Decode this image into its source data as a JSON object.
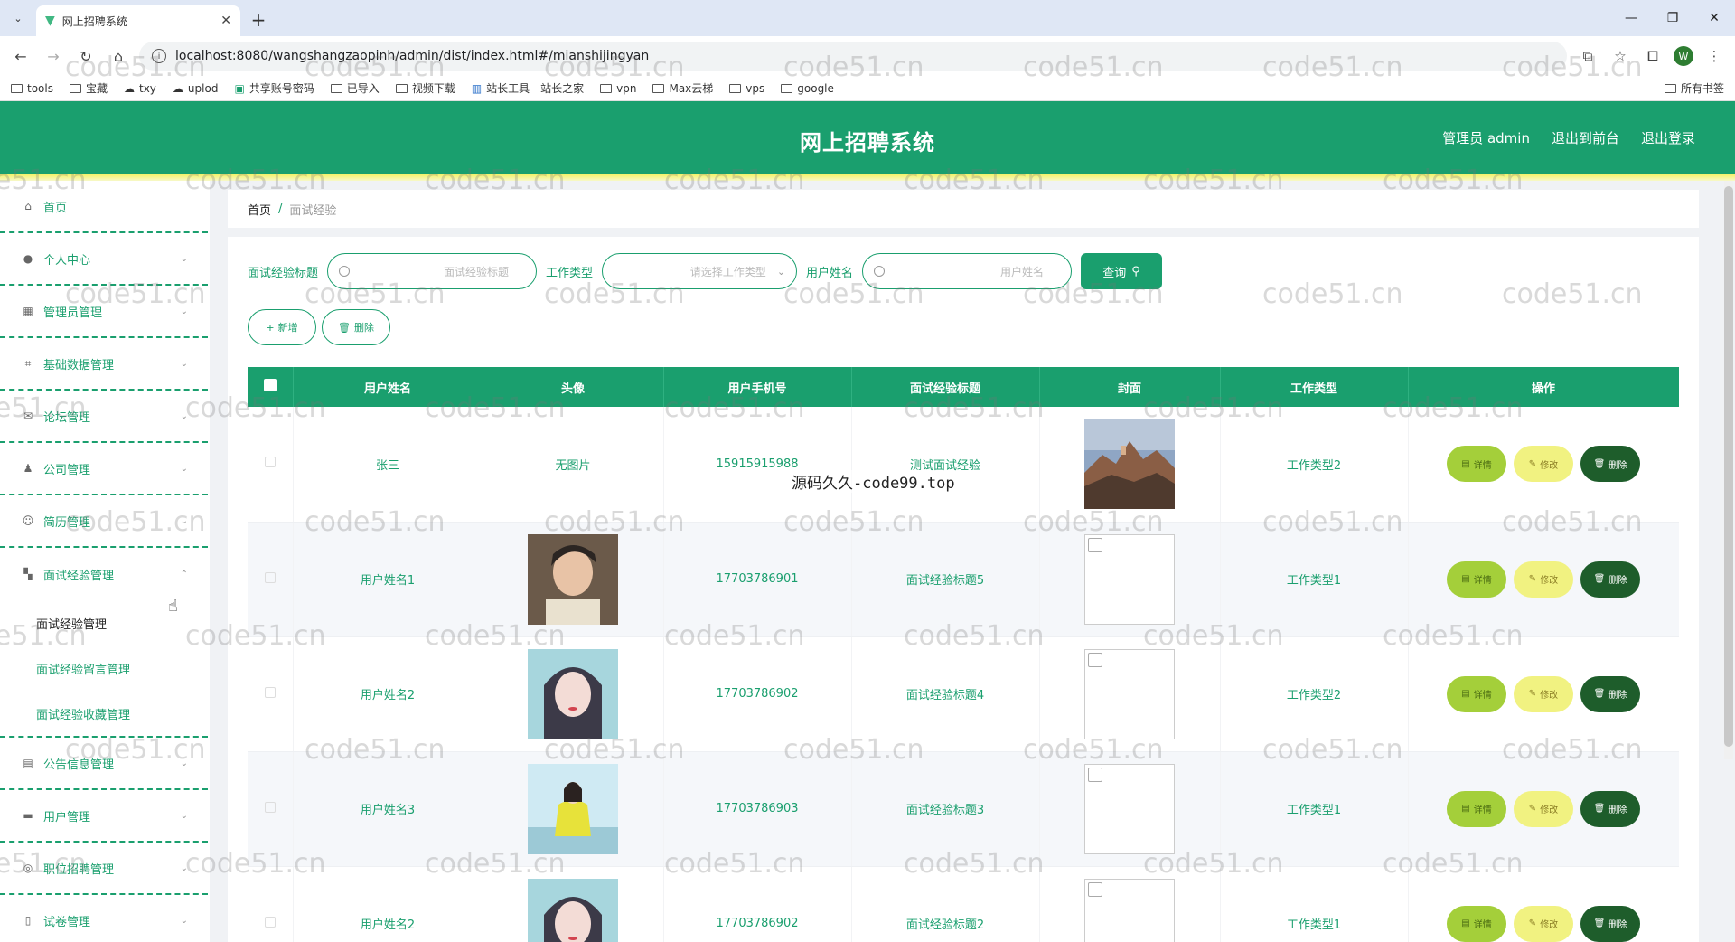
{
  "browser": {
    "tab_title": "网上招聘系统",
    "url": "localhost:8080/wangshangzaopinh/admin/dist/index.html#/mianshijingyan",
    "profile_initial": "W",
    "bookmarks": [
      "tools",
      "宝藏",
      "txy",
      "uplod",
      "共享账号密码",
      "已导入",
      "视频下载",
      "站长工具 - 站长之家",
      "vpn",
      "Max云梯",
      "vps",
      "google"
    ],
    "all_bookmarks": "所有书签"
  },
  "header": {
    "title": "网上招聘系统",
    "admin_label": "管理员 admin",
    "to_front": "退出到前台",
    "logout": "退出登录"
  },
  "sidebar": {
    "items": [
      {
        "label": "首页",
        "icon": "home-icon"
      },
      {
        "label": "个人中心",
        "icon": "user-icon"
      },
      {
        "label": "管理员管理",
        "icon": "admin-icon"
      },
      {
        "label": "基础数据管理",
        "icon": "crop-icon"
      },
      {
        "label": "论坛管理",
        "icon": "mail-icon"
      },
      {
        "label": "公司管理",
        "icon": "person-icon"
      },
      {
        "label": "简历管理",
        "icon": "smile-icon"
      },
      {
        "label": "面试经验管理",
        "icon": "grid-icon"
      }
    ],
    "sub_items": [
      "面试经验管理",
      "面试经验留言管理",
      "面试经验收藏管理"
    ],
    "items_after": [
      {
        "label": "公告信息管理",
        "icon": "notice-icon"
      },
      {
        "label": "用户管理",
        "icon": "monitor-icon"
      },
      {
        "label": "职位招聘管理",
        "icon": "globe-icon"
      },
      {
        "label": "试卷管理",
        "icon": "phone-icon"
      }
    ]
  },
  "breadcrumb": {
    "home": "首页",
    "separator": "/",
    "current": "面试经验"
  },
  "search": {
    "title_label": "面试经验标题",
    "title_placeholder": "面试经验标题",
    "type_label": "工作类型",
    "type_placeholder": "请选择工作类型",
    "user_label": "用户姓名",
    "user_placeholder": "用户姓名",
    "query_label": "查询"
  },
  "actions": {
    "add_label": "新增",
    "delete_label": "删除"
  },
  "table": {
    "columns": [
      "用户姓名",
      "头像",
      "用户手机号",
      "面试经验标题",
      "封面",
      "工作类型",
      "操作"
    ],
    "rows": [
      {
        "name": "张三",
        "avatar": "无图片",
        "phone": "15915915988",
        "title": "测试面试经验",
        "type": "工作类型2"
      },
      {
        "name": "用户姓名1",
        "avatar": "",
        "phone": "17703786901",
        "title": "面试经验标题5",
        "type": "工作类型1"
      },
      {
        "name": "用户姓名2",
        "avatar": "",
        "phone": "17703786902",
        "title": "面试经验标题4",
        "type": "工作类型2"
      },
      {
        "name": "用户姓名3",
        "avatar": "",
        "phone": "17703786903",
        "title": "面试经验标题3",
        "type": "工作类型1"
      },
      {
        "name": "用户姓名2",
        "avatar": "",
        "phone": "17703786902",
        "title": "面试经验标题2",
        "type": "工作类型1"
      }
    ],
    "op_detail": "详情",
    "op_edit": "修改",
    "op_delete": "删除"
  },
  "watermark": {
    "text": "code51.cn",
    "center_text": "源码久久-code99.top"
  },
  "colors": {
    "primary": "#1a9f6e",
    "accent_yellow": "#f4f15a",
    "detail_btn": "#a4cf3a",
    "edit_btn": "#f1f281",
    "delete_btn": "#1e5d2b"
  }
}
